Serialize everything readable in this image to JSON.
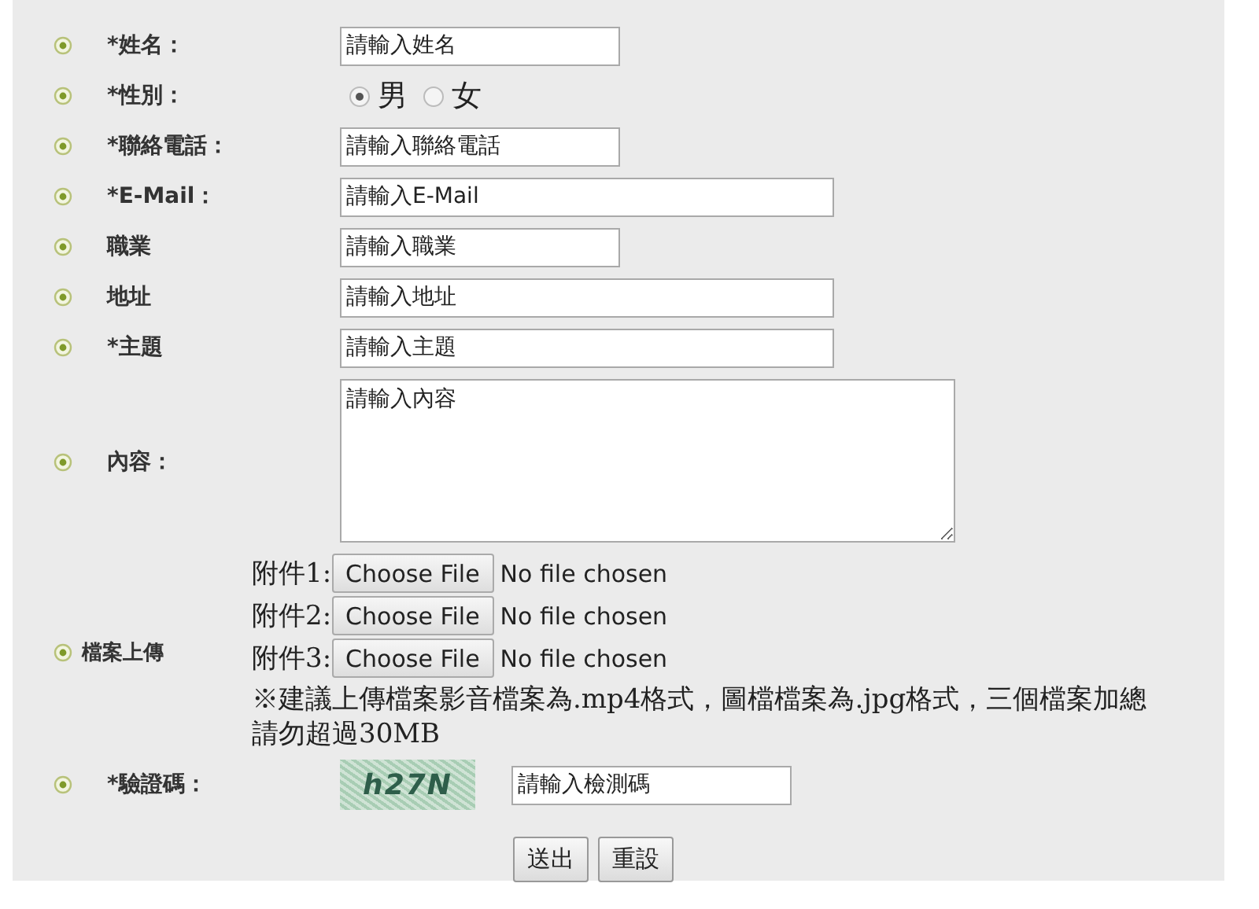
{
  "fields": [
    {
      "kind": "short-text",
      "label": "*姓名：",
      "placeholder": "請輸入姓名"
    },
    {
      "kind": "radio",
      "label": "*性別：",
      "options": [
        {
          "label": "男",
          "selected": true
        },
        {
          "label": "女",
          "selected": false
        }
      ]
    },
    {
      "kind": "short-text",
      "label": "*聯絡電話：",
      "placeholder": "請輸入聯絡電話"
    },
    {
      "kind": "long-text",
      "label": "*E-Mail：",
      "placeholder": "請輸入E-Mail"
    },
    {
      "kind": "short-text",
      "label": "職業",
      "placeholder": "請輸入職業"
    },
    {
      "kind": "long-text",
      "label": "地址",
      "placeholder": "請輸入地址"
    },
    {
      "kind": "long-text",
      "label": "*主題",
      "placeholder": "請輸入主題"
    },
    {
      "kind": "textarea",
      "label": "內容：",
      "placeholder": "請輸入內容"
    },
    {
      "kind": "files",
      "label": "檔案上傳",
      "files": [
        {
          "label": "附件1:",
          "button": "Choose File",
          "status": "No file chosen"
        },
        {
          "label": "附件2:",
          "button": "Choose File",
          "status": "No file chosen"
        },
        {
          "label": "附件3:",
          "button": "Choose File",
          "status": "No file chosen"
        }
      ],
      "note": "※建議上傳檔案影音檔案為.mp4格式，圖檔檔案為.jpg格式，三個檔案加總請勿超過30MB"
    },
    {
      "kind": "captcha",
      "label": "*驗證碼：",
      "code": "h27N",
      "placeholder": "請輸入檢測碼"
    }
  ],
  "buttons": [
    "送出",
    "重設"
  ]
}
